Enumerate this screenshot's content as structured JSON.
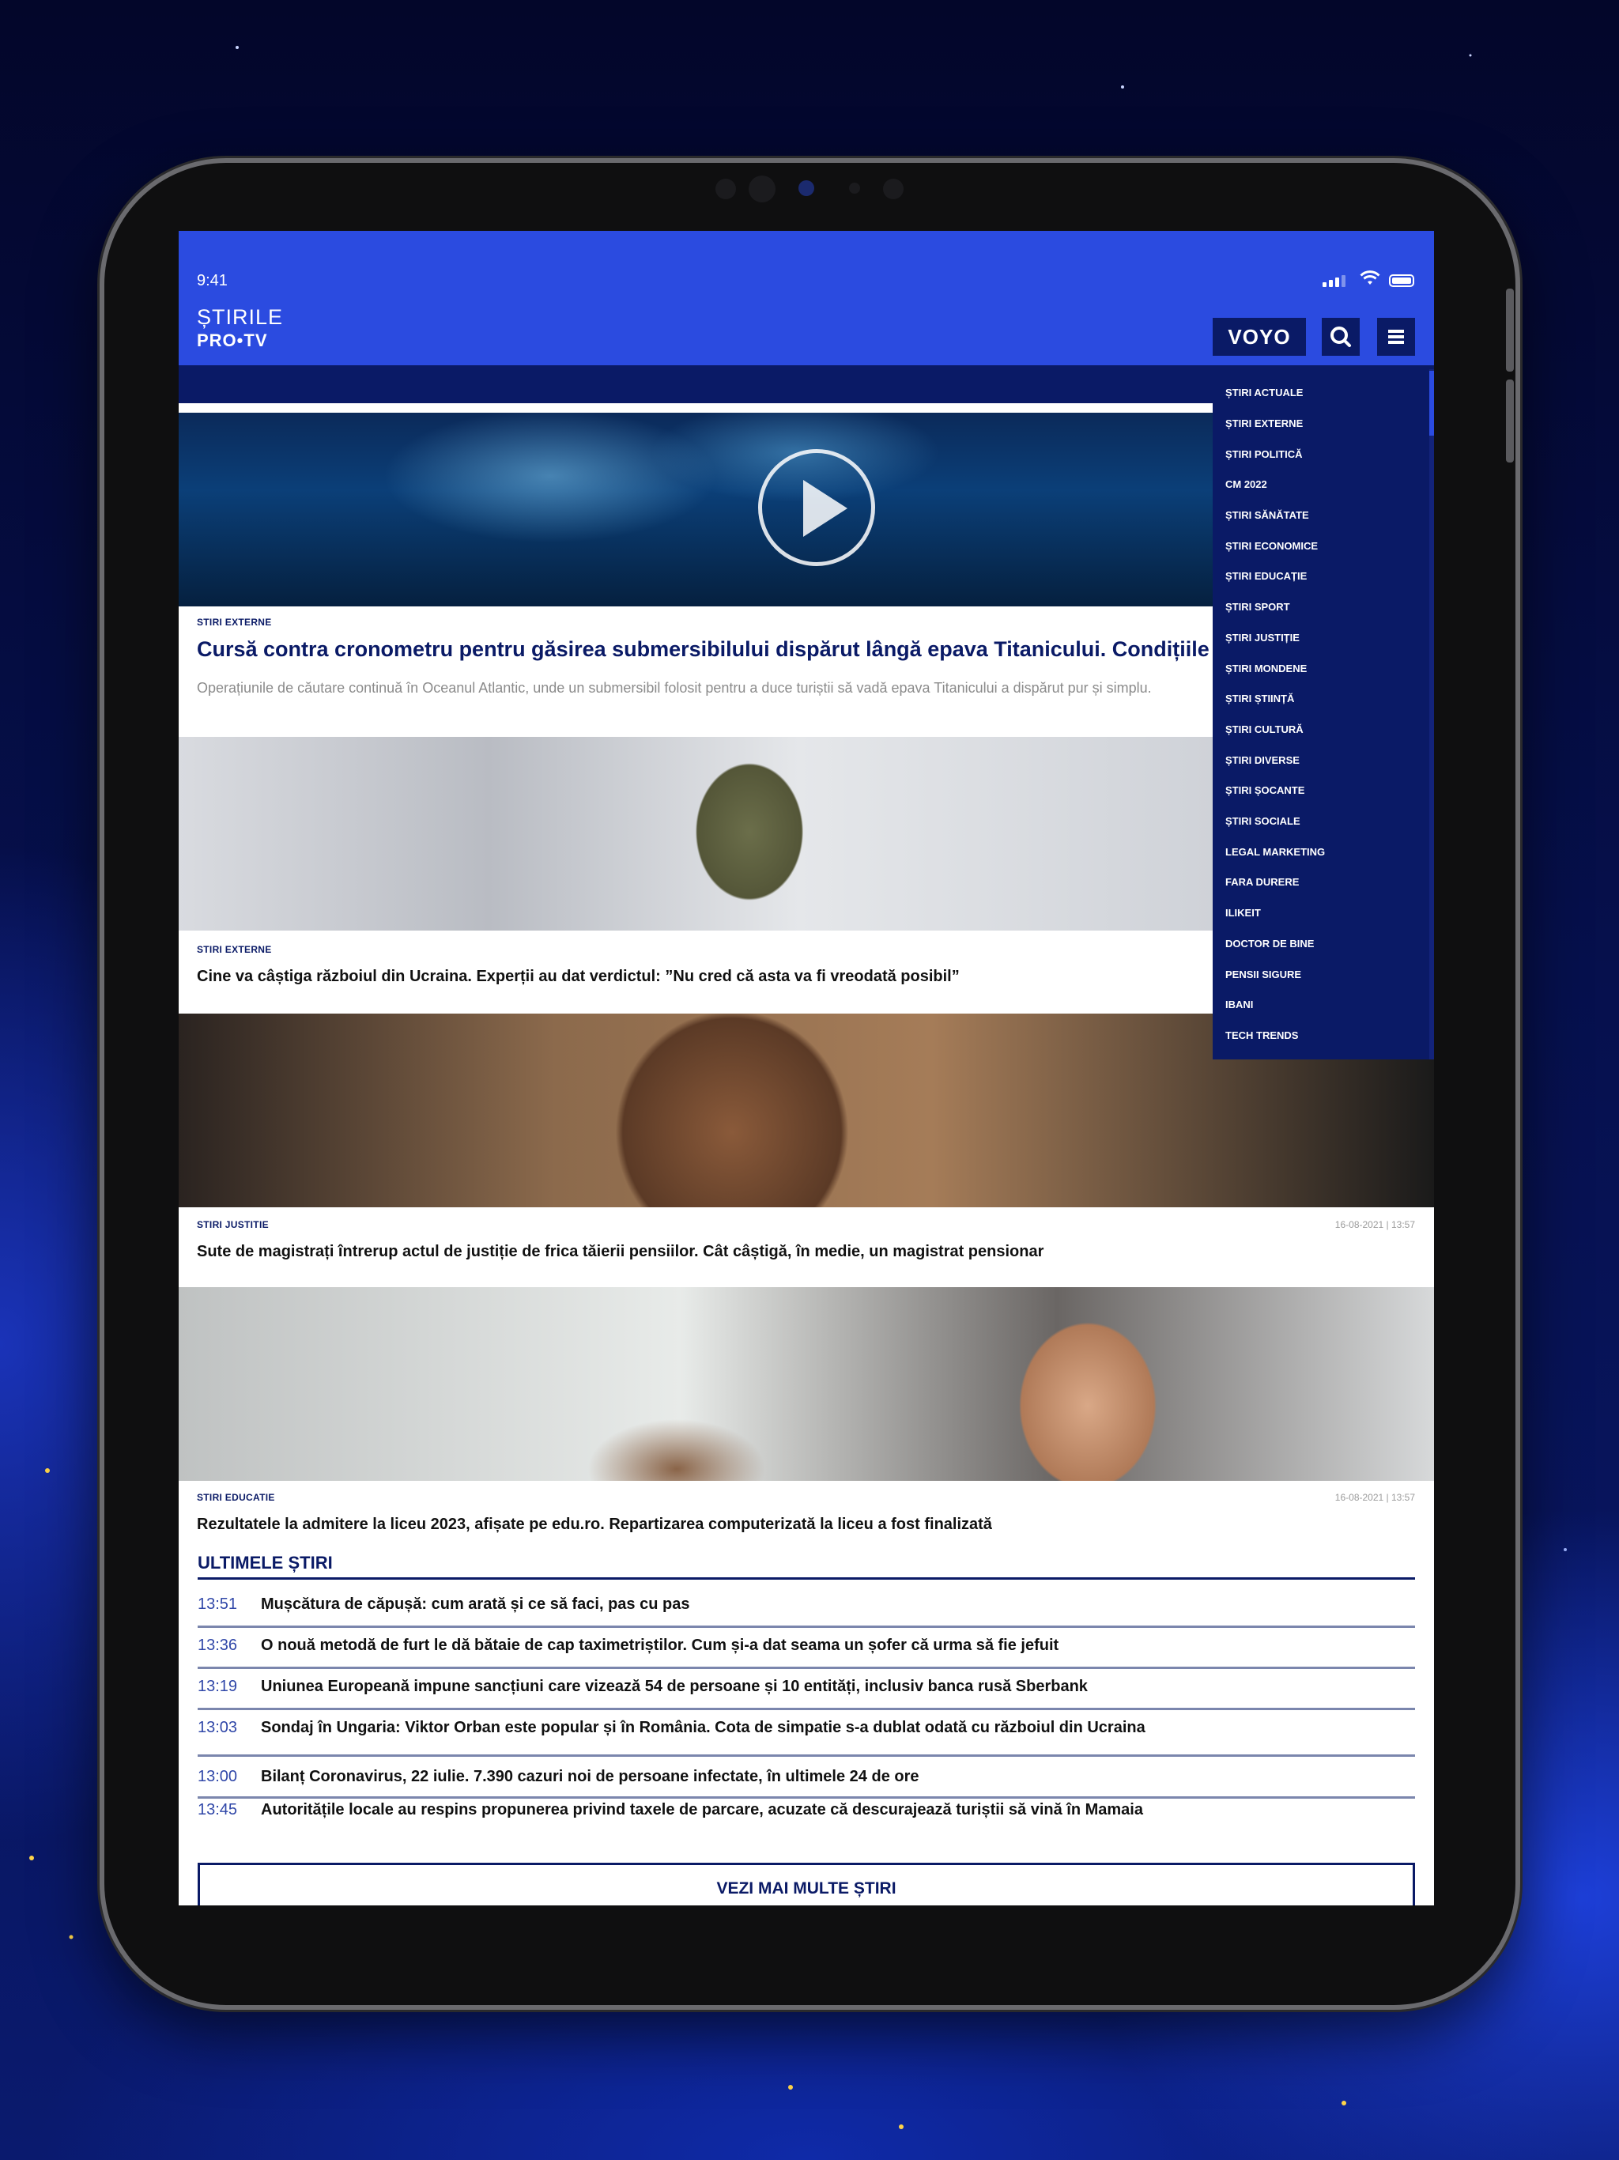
{
  "status_bar": {
    "time": "9:41"
  },
  "header": {
    "logo_line1": "ȘTIRILE",
    "logo_line2": "PRO•TV",
    "voyo_label": "VOYO"
  },
  "menu": {
    "items": [
      "ȘTIRI ACTUALE",
      "ȘTIRI EXTERNE",
      "ȘTIRI POLITICĂ",
      "CM 2022",
      "ȘTIRI SĂNĂTATE",
      "ȘTIRI ECONOMICE",
      "ȘTIRI EDUCAȚIE",
      "ȘTIRI SPORT",
      "ȘTIRI JUSTIȚIE",
      "ȘTIRI MONDENE",
      "ȘTIRI ȘTIINȚĂ",
      "ȘTIRI CULTURĂ",
      "ȘTIRI DIVERSE",
      "ȘTIRI ȘOCANTE",
      "ȘTIRI SOCIALE",
      "LEGAL MARKETING",
      "FARA DURERE",
      "ILIKEIT",
      "DOCTOR DE BINE",
      "PENSII SIGURE",
      "IBANI",
      "TECH TRENDS"
    ]
  },
  "articles": [
    {
      "category": "STIRI EXTERNE",
      "title": "Cursă contra cronometru pentru găsirea submersibilului dispărut lângă epava Titanicului. Condițiile sunt ”ca",
      "summary": "Operațiunile de căutare continuă în Oceanul Atlantic, unde un submersibil folosit pentru a duce turiștii să vadă epava Titanicului a dispărut pur și simplu."
    },
    {
      "category": "STIRI EXTERNE",
      "title": "Cine va câștiga războiul din Ucraina. Experții au dat verdictul: ”Nu cred că asta va fi vreodată posibil”"
    },
    {
      "category": "STIRI JUSTITIE",
      "date": "16-08-2021 | 13:57",
      "title": "Sute de magistrați întrerup actul de justiție de frica tăierii pensiilor. Cât câștigă, în medie, un magistrat pensionar"
    },
    {
      "category": "STIRI EDUCATIE",
      "date": "16-08-2021 | 13:57",
      "title": "Rezultatele la admitere la liceu 2023, afișate pe edu.ro. Repartizarea computerizată la liceu a fost finalizată"
    }
  ],
  "latest": {
    "heading": "ULTIMELE ȘTIRI",
    "items": [
      {
        "time": "13:51",
        "title": "Mușcătura de căpușă: cum arată și ce să faci, pas cu pas"
      },
      {
        "time": "13:36",
        "title": "O nouă metodă de furt le dă bătaie de cap taximetriștilor. Cum și-a dat seama un șofer că urma să fie jefuit"
      },
      {
        "time": "13:19",
        "title": "Uniunea Europeană impune sancțiuni care vizează 54 de persoane și 10 entități, inclusiv banca rusă Sberbank"
      },
      {
        "time": "13:03",
        "title": "Sondaj în Ungaria: Viktor Orban este popular și în România. Cota de simpatie s-a dublat odată cu războiul din Ucraina"
      },
      {
        "time": "13:00",
        "title": "Bilanț Coronavirus, 22 iulie. 7.390 cazuri noi de persoane infectate, în ultimele 24 de ore"
      },
      {
        "time": "13:45",
        "title": "Autoritățile locale au respins propunerea privind taxele de parcare, acuzate că descurajează turiștii să vină în Mamaia"
      }
    ],
    "more_label": "VEZI MAI MULTE ȘTIRI"
  },
  "colors": {
    "brand_blue": "#2b4be0",
    "navy": "#0a1a66"
  }
}
